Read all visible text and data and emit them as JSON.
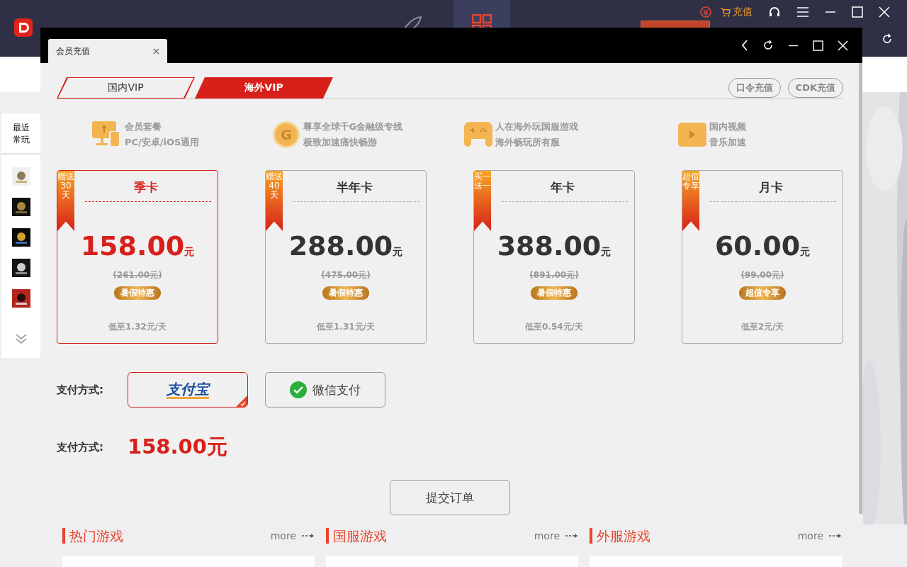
{
  "app": {
    "recharge": "充值"
  },
  "sidebar": {
    "title": "最近常玩"
  },
  "sections": [
    {
      "title": "热门游戏",
      "more": "more"
    },
    {
      "title": "国服游戏",
      "more": "more"
    },
    {
      "title": "外服游戏",
      "more": "more"
    }
  ],
  "modal": {
    "tab_title": "会员充值",
    "vip_tabs": [
      {
        "label": "国内VIP",
        "selected": false
      },
      {
        "label": "海外VIP",
        "selected": true
      }
    ],
    "code_buttons": [
      "口令充值",
      "CDK充值"
    ],
    "features": [
      {
        "kind": "devices",
        "line1": "会员套餐",
        "line2": "PC/安卓/iOS通用"
      },
      {
        "kind": "coin",
        "coin_letter": "G",
        "line1": "尊享全球千G金融级专线",
        "line2": "极致加速痛快畅游"
      },
      {
        "kind": "gamepad",
        "line1": "人在海外玩国服游戏",
        "line2": "海外畅玩所有服"
      },
      {
        "kind": "play",
        "line1": "国内视频",
        "line2": "音乐加速"
      }
    ],
    "plans": [
      {
        "ribbon": "赠送30天",
        "name": "季卡",
        "price": "158.00",
        "unit": "元",
        "original": "(261.00元)",
        "badge": "暑假特惠",
        "per_day": "低至1.32元/天",
        "selected": true
      },
      {
        "ribbon": "赠送40天",
        "name": "半年卡",
        "price": "288.00",
        "unit": "元",
        "original": "(475.00元)",
        "badge": "暑假特惠",
        "per_day": "低至1.31元/天",
        "selected": false
      },
      {
        "ribbon": "买一送一",
        "name": "年卡",
        "price": "388.00",
        "unit": "元",
        "original": "(891.00元)",
        "badge": "暑假特惠",
        "per_day": "低至0.54元/天",
        "selected": false
      },
      {
        "ribbon": "超值专享",
        "name": "月卡",
        "price": "60.00",
        "unit": "元",
        "original": "(99.00元)",
        "badge": "超值专享",
        "per_day": "低至2元/天",
        "selected": false
      }
    ],
    "payment": {
      "label": "支付方式:",
      "methods": [
        {
          "kind": "alipay",
          "label": "支付宝",
          "selected": true
        },
        {
          "kind": "wechat",
          "label": "微信支付",
          "selected": false
        }
      ]
    },
    "total": {
      "label": "支付方式:",
      "amount": "158.00元"
    },
    "submit": "提交订单"
  }
}
